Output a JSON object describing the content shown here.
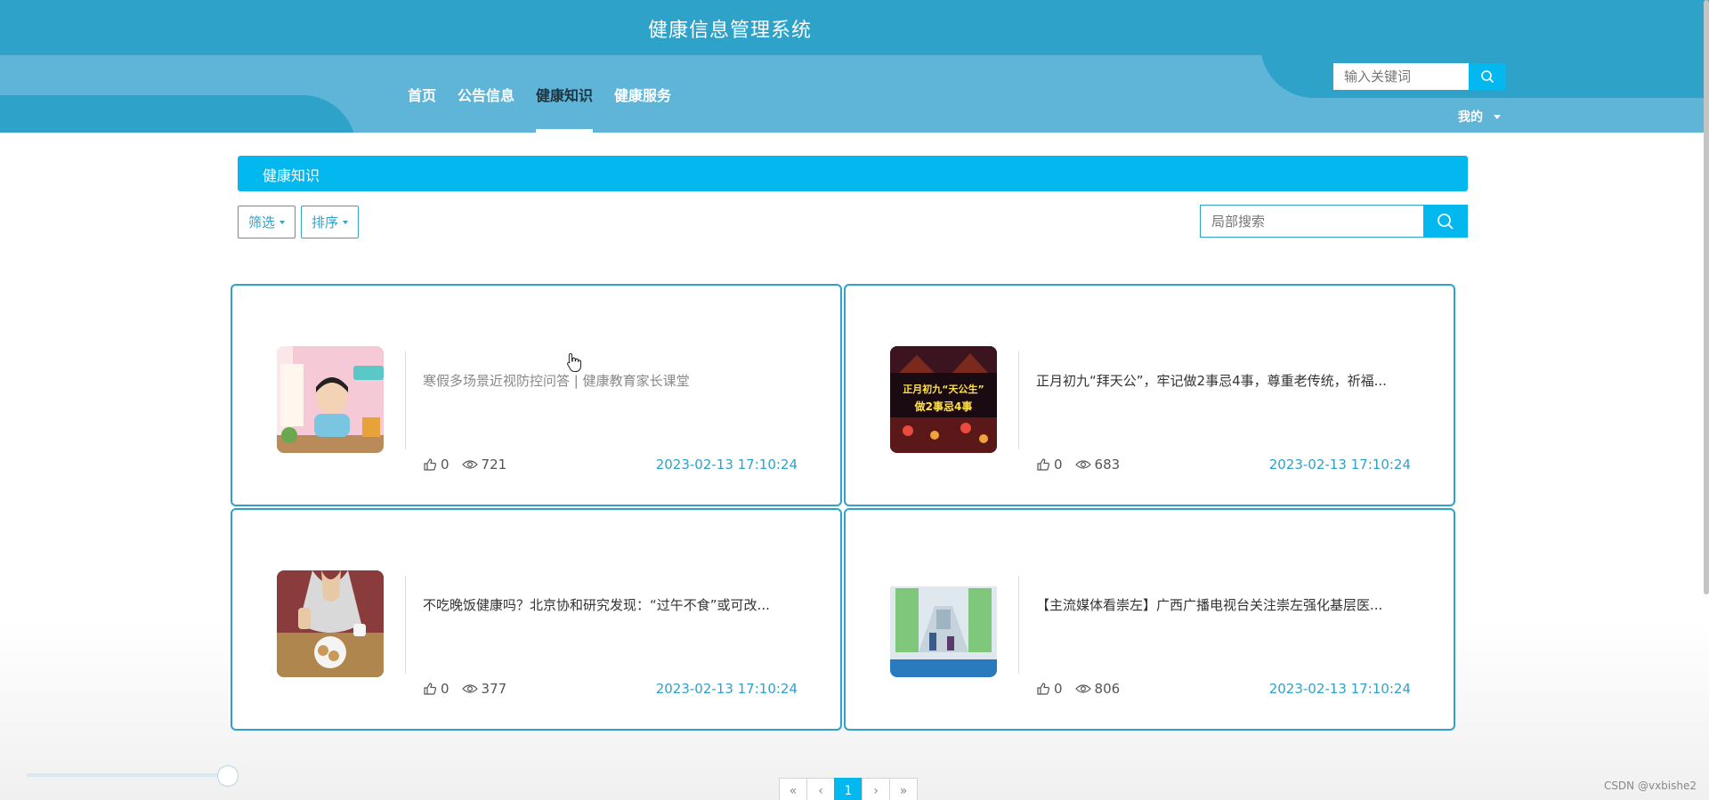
{
  "header": {
    "title": "健康信息管理系统",
    "nav": [
      "首页",
      "公告信息",
      "健康知识",
      "健康服务"
    ],
    "active_index": 2,
    "search_placeholder": "输入关键词",
    "user_menu": "我的"
  },
  "section": {
    "title": "健康知识",
    "filter_label": "筛选",
    "sort_label": "排序",
    "local_search_placeholder": "局部搜索"
  },
  "cards": [
    {
      "title": "寒假多场景近视防控问答 | 健康教育家长课堂",
      "likes": "0",
      "views": "721",
      "date": "2023-02-13 17:10:24"
    },
    {
      "title": "正月初九“拜天公”，牢记做2事忌4事，尊重老传统，祈福...",
      "likes": "0",
      "views": "683",
      "date": "2023-02-13 17:10:24"
    },
    {
      "title": "不吃晚饭健康吗？北京协和研究发现：“过午不食”或可改...",
      "likes": "0",
      "views": "377",
      "date": "2023-02-13 17:10:24"
    },
    {
      "title": "【主流媒体看崇左】广西广播电视台关注崇左强化基层医...",
      "likes": "0",
      "views": "806",
      "date": "2023-02-13 17:10:24"
    }
  ],
  "thumb_text": {
    "card2": "正月初九“天公生” 做2事忌4事"
  },
  "pagination": {
    "first": "«",
    "prev": "‹",
    "current": "1",
    "next": "›",
    "last": "»"
  },
  "watermark": "CSDN @vxbishe2",
  "colors": {
    "header": "#2ea2c9",
    "nav_band": "#5fb5d8",
    "accent": "#03b8ee",
    "card_border": "#2ea2c9"
  }
}
